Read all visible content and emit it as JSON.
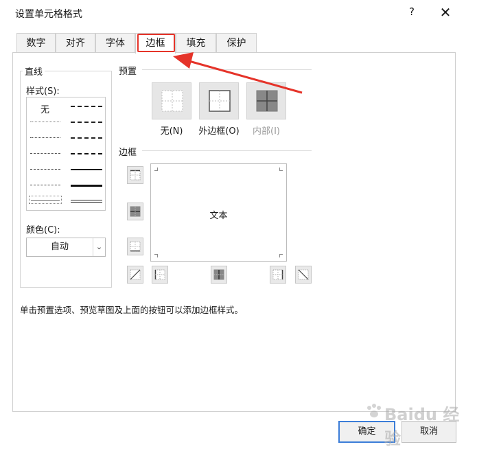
{
  "window": {
    "title": "设置单元格格式",
    "help_label": "?",
    "close_label": "✕"
  },
  "tabs": [
    {
      "label": "数字"
    },
    {
      "label": "对齐"
    },
    {
      "label": "字体"
    },
    {
      "label": "边框",
      "active": true
    },
    {
      "label": "填充"
    },
    {
      "label": "保护"
    }
  ],
  "line": {
    "group_title": "直线",
    "style_label": "样式(S):",
    "none_label": "无",
    "color_label": "颜色(C):",
    "color_value": "自动",
    "color_arrow": "⌄"
  },
  "presets": {
    "section_title": "预置",
    "items": [
      {
        "label": "无(N)",
        "icon": "no-border-icon",
        "enabled": true
      },
      {
        "label": "外边框(O)",
        "icon": "outline-border-icon",
        "enabled": true
      },
      {
        "label": "内部(I)",
        "icon": "inside-border-icon",
        "enabled": false
      }
    ]
  },
  "border": {
    "section_title": "边框",
    "preview_text": "文本",
    "buttons": [
      "top-border-icon",
      "inside-horizontal-border-icon",
      "bottom-border-icon",
      "diagonal-up-border-icon",
      "left-border-icon",
      "inside-vertical-border-icon",
      "right-border-icon",
      "diagonal-down-border-icon"
    ]
  },
  "hint": "单击预置选项、预览草图及上面的按钮可以添加边框样式。",
  "footer": {
    "ok_label": "确定",
    "cancel_label": "取消"
  },
  "watermark": {
    "text": "Baidu 经验"
  },
  "colors": {
    "highlight": "#e53329",
    "ok_border": "#3b7dd8"
  }
}
